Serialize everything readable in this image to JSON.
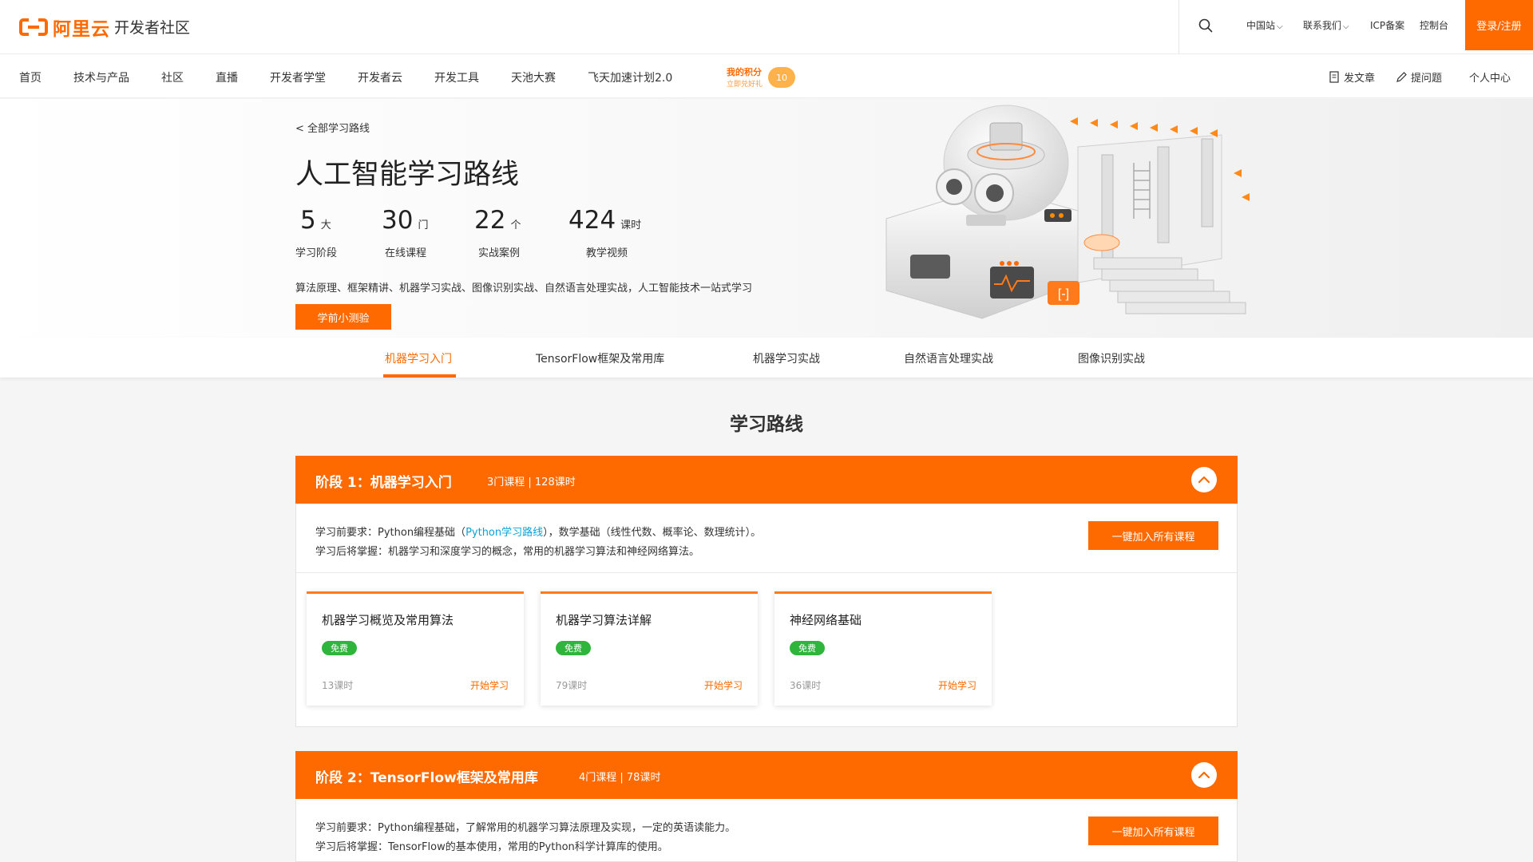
{
  "header": {
    "logo_text": "阿里云",
    "site_name": "开发者社区",
    "links": [
      "中国站",
      "联系我们",
      "ICP备案",
      "控制台"
    ],
    "login_label": "登录/注册"
  },
  "nav": {
    "items": [
      "首页",
      "技术与产品",
      "社区",
      "直播",
      "开发者学堂",
      "开发者云",
      "开发工具",
      "天池大赛",
      "飞天加速计划2.0"
    ],
    "points_title": "我的积分",
    "points_sub": "立即兑好礼",
    "points_value": "10",
    "right": [
      "发文章",
      "提问题",
      "个人中心"
    ]
  },
  "banner": {
    "back_label": "< 全部学习路线",
    "title": "人工智能学习路线",
    "stats": [
      {
        "num": "5",
        "unit": "大",
        "label": "学习阶段"
      },
      {
        "num": "30",
        "unit": "门",
        "label": "在线课程"
      },
      {
        "num": "22",
        "unit": "个",
        "label": "实战案例"
      },
      {
        "num": "424",
        "unit": "课时",
        "label": "教学视频"
      }
    ],
    "description": "算法原理、框架精讲、机器学习实战、图像识别实战、自然语言处理实战，人工智能技术一站式学习",
    "quiz_label": "学前小测验"
  },
  "tabs": [
    "机器学习入门",
    "TensorFlow框架及常用库",
    "机器学习实战",
    "自然语言处理实战",
    "图像识别实战"
  ],
  "section_title": "学习路线",
  "stages": [
    {
      "name": "阶段 1：机器学习入门",
      "meta": "3门课程 | 128课时",
      "req_prefix": "学习前要求：Python编程基础（",
      "req_link": "Python学习路线",
      "req_suffix": "），数学基础（线性代数、概率论、数理统计）。",
      "outcome": "学习后将掌握：机器学习和深度学习的概念，常用的机器学习算法和神经网络算法。",
      "join_label": "一键加入所有课程",
      "courses": [
        {
          "title": "机器学习概览及常用算法",
          "badge": "免费",
          "hours": "13课时",
          "action": "开始学习"
        },
        {
          "title": "机器学习算法详解",
          "badge": "免费",
          "hours": "79课时",
          "action": "开始学习"
        },
        {
          "title": "神经网络基础",
          "badge": "免费",
          "hours": "36课时",
          "action": "开始学习"
        }
      ]
    },
    {
      "name": "阶段 2：TensorFlow框架及常用库",
      "meta": "4门课程 | 78课时",
      "requirement": "学习前要求：Python编程基础，了解常用的机器学习算法原理及实现，一定的英语读能力。",
      "outcome": "学习后将掌握：TensorFlow的基本使用，常用的Python科学计算库的使用。",
      "join_label": "一键加入所有课程"
    }
  ],
  "colors": {
    "accent": "#ff6a00",
    "free_badge": "#2fb53b",
    "link": "#0aa2d6"
  }
}
